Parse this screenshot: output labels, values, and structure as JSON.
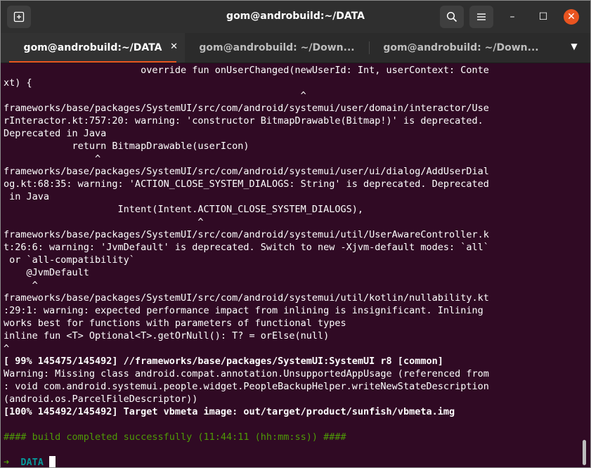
{
  "window": {
    "title": "gom@androbuild:~/DATA",
    "controls": {
      "minimize": "–",
      "maximize": "☐",
      "close": "✕"
    }
  },
  "tabs": [
    {
      "label": "gom@androbuild:~/DATA",
      "close": "✕",
      "active": true
    },
    {
      "label": "gom@androbuild: ~/Down...",
      "active": false
    },
    {
      "label": "gom@androbuild: ~/Down...",
      "active": false
    }
  ],
  "tabs_dropdown": "▼",
  "terminal": {
    "lines": [
      {
        "text": "                        override fun onUserChanged(newUserId: Int, userContext: Conte",
        "style": ""
      },
      {
        "text": "xt) {",
        "style": ""
      },
      {
        "text": "                                                    ^",
        "style": ""
      },
      {
        "text": "frameworks/base/packages/SystemUI/src/com/android/systemui/user/domain/interactor/Use",
        "style": ""
      },
      {
        "text": "rInteractor.kt:757:20: warning: 'constructor BitmapDrawable(Bitmap!)' is deprecated.",
        "style": ""
      },
      {
        "text": "Deprecated in Java",
        "style": ""
      },
      {
        "text": "            return BitmapDrawable(userIcon)",
        "style": ""
      },
      {
        "text": "                ^",
        "style": ""
      },
      {
        "text": "frameworks/base/packages/SystemUI/src/com/android/systemui/user/ui/dialog/AddUserDial",
        "style": ""
      },
      {
        "text": "og.kt:68:35: warning: 'ACTION_CLOSE_SYSTEM_DIALOGS: String' is deprecated. Deprecated",
        "style": ""
      },
      {
        "text": " in Java",
        "style": ""
      },
      {
        "text": "                    Intent(Intent.ACTION_CLOSE_SYSTEM_DIALOGS),",
        "style": ""
      },
      {
        "text": "                                  ^",
        "style": ""
      },
      {
        "text": "frameworks/base/packages/SystemUI/src/com/android/systemui/util/UserAwareController.k",
        "style": ""
      },
      {
        "text": "t:26:6: warning: 'JvmDefault' is deprecated. Switch to new -Xjvm-default modes: `all`",
        "style": ""
      },
      {
        "text": " or `all-compatibility`",
        "style": ""
      },
      {
        "text": "    @JvmDefault",
        "style": ""
      },
      {
        "text": "     ^",
        "style": ""
      },
      {
        "text": "frameworks/base/packages/SystemUI/src/com/android/systemui/util/kotlin/nullability.kt",
        "style": ""
      },
      {
        "text": ":29:1: warning: expected performance impact from inlining is insignificant. Inlining",
        "style": ""
      },
      {
        "text": "works best for functions with parameters of functional types",
        "style": ""
      },
      {
        "text": "inline fun <T> Optional<T>.getOrNull(): T? = orElse(null)",
        "style": ""
      },
      {
        "text": "^",
        "style": ""
      },
      {
        "text": "[ 99% 145475/145492] //frameworks/base/packages/SystemUI:SystemUI r8 [common]",
        "style": "bold"
      },
      {
        "text": "Warning: Missing class android.compat.annotation.UnsupportedAppUsage (referenced from",
        "style": ""
      },
      {
        "text": ": void com.android.systemui.people.widget.PeopleBackupHelper.writeNewStateDescription",
        "style": ""
      },
      {
        "text": "(android.os.ParcelFileDescriptor))",
        "style": ""
      },
      {
        "text": "[100% 145492/145492] Target vbmeta image: out/target/product/sunfish/vbmeta.img",
        "style": "bold"
      },
      {
        "text": "",
        "style": ""
      },
      {
        "text": "#### build completed successfully (11:44:11 (hh:mm:ss)) ####",
        "style": "green"
      },
      {
        "text": "",
        "style": ""
      }
    ],
    "prompt": {
      "arrow": "➜",
      "dir": "DATA"
    }
  }
}
